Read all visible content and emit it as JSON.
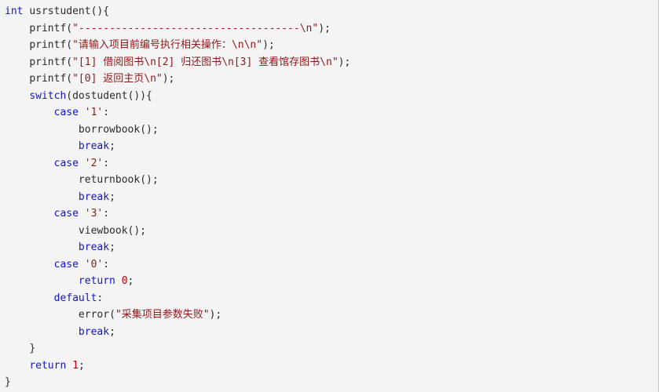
{
  "editor": {
    "language": "c",
    "background_color": "#f4f4f4",
    "colors": {
      "keyword": "#1515c4",
      "string": "#8b1a1a",
      "number": "#b8000c",
      "identifier": "#2b2b2b",
      "punctuation": "#2b2b2b"
    }
  },
  "code": {
    "lines": [
      {
        "indent": 0,
        "tokens": [
          {
            "kind": "kw",
            "text": "int"
          },
          {
            "kind": "plain",
            "text": " "
          },
          {
            "kind": "id",
            "text": "usrstudent"
          },
          {
            "kind": "punc",
            "text": "(){"
          }
        ]
      },
      {
        "indent": 1,
        "tokens": [
          {
            "kind": "id",
            "text": "printf"
          },
          {
            "kind": "punc",
            "text": "("
          },
          {
            "kind": "str",
            "text": "\"------------------------------------\\n\""
          },
          {
            "kind": "punc",
            "text": ");"
          }
        ]
      },
      {
        "indent": 1,
        "tokens": [
          {
            "kind": "id",
            "text": "printf"
          },
          {
            "kind": "punc",
            "text": "("
          },
          {
            "kind": "str",
            "text": "\"请输入项目前编号执行相关操作：\\n\\n\""
          },
          {
            "kind": "punc",
            "text": ");"
          }
        ]
      },
      {
        "indent": 1,
        "tokens": [
          {
            "kind": "id",
            "text": "printf"
          },
          {
            "kind": "punc",
            "text": "("
          },
          {
            "kind": "str",
            "text": "\"[1] 借阅图书\\n[2] 归还图书\\n[3] 查看馆存图书\\n\""
          },
          {
            "kind": "punc",
            "text": ");"
          }
        ]
      },
      {
        "indent": 1,
        "tokens": [
          {
            "kind": "id",
            "text": "printf"
          },
          {
            "kind": "punc",
            "text": "("
          },
          {
            "kind": "str",
            "text": "\"[0] 返回主页\\n\""
          },
          {
            "kind": "punc",
            "text": ");"
          }
        ]
      },
      {
        "indent": 1,
        "tokens": [
          {
            "kind": "kw",
            "text": "switch"
          },
          {
            "kind": "punc",
            "text": "("
          },
          {
            "kind": "id",
            "text": "dostudent"
          },
          {
            "kind": "punc",
            "text": "()){"
          }
        ]
      },
      {
        "indent": 2,
        "tokens": [
          {
            "kind": "kw",
            "text": "case"
          },
          {
            "kind": "plain",
            "text": " "
          },
          {
            "kind": "str",
            "text": "'1'"
          },
          {
            "kind": "punc",
            "text": ":"
          }
        ]
      },
      {
        "indent": 3,
        "tokens": [
          {
            "kind": "id",
            "text": "borrowbook"
          },
          {
            "kind": "punc",
            "text": "();"
          }
        ]
      },
      {
        "indent": 3,
        "tokens": [
          {
            "kind": "kw",
            "text": "break"
          },
          {
            "kind": "punc",
            "text": ";"
          }
        ]
      },
      {
        "indent": 2,
        "tokens": [
          {
            "kind": "kw",
            "text": "case"
          },
          {
            "kind": "plain",
            "text": " "
          },
          {
            "kind": "str",
            "text": "'2'"
          },
          {
            "kind": "punc",
            "text": ":"
          }
        ]
      },
      {
        "indent": 3,
        "tokens": [
          {
            "kind": "id",
            "text": "returnbook"
          },
          {
            "kind": "punc",
            "text": "();"
          }
        ]
      },
      {
        "indent": 3,
        "tokens": [
          {
            "kind": "kw",
            "text": "break"
          },
          {
            "kind": "punc",
            "text": ";"
          }
        ]
      },
      {
        "indent": 2,
        "tokens": [
          {
            "kind": "kw",
            "text": "case"
          },
          {
            "kind": "plain",
            "text": " "
          },
          {
            "kind": "str",
            "text": "'3'"
          },
          {
            "kind": "punc",
            "text": ":"
          }
        ]
      },
      {
        "indent": 3,
        "tokens": [
          {
            "kind": "id",
            "text": "viewbook"
          },
          {
            "kind": "punc",
            "text": "();"
          }
        ]
      },
      {
        "indent": 3,
        "tokens": [
          {
            "kind": "kw",
            "text": "break"
          },
          {
            "kind": "punc",
            "text": ";"
          }
        ]
      },
      {
        "indent": 2,
        "tokens": [
          {
            "kind": "kw",
            "text": "case"
          },
          {
            "kind": "plain",
            "text": " "
          },
          {
            "kind": "str",
            "text": "'0'"
          },
          {
            "kind": "punc",
            "text": ":"
          }
        ]
      },
      {
        "indent": 3,
        "tokens": [
          {
            "kind": "kw",
            "text": "return"
          },
          {
            "kind": "plain",
            "text": " "
          },
          {
            "kind": "num",
            "text": "0"
          },
          {
            "kind": "punc",
            "text": ";"
          }
        ]
      },
      {
        "indent": 2,
        "tokens": [
          {
            "kind": "kw",
            "text": "default"
          },
          {
            "kind": "punc",
            "text": ":"
          }
        ]
      },
      {
        "indent": 3,
        "tokens": [
          {
            "kind": "id",
            "text": "error"
          },
          {
            "kind": "punc",
            "text": "("
          },
          {
            "kind": "str",
            "text": "\"采集项目参数失败\""
          },
          {
            "kind": "punc",
            "text": ");"
          }
        ]
      },
      {
        "indent": 3,
        "tokens": [
          {
            "kind": "kw",
            "text": "break"
          },
          {
            "kind": "punc",
            "text": ";"
          }
        ]
      },
      {
        "indent": 1,
        "tokens": [
          {
            "kind": "punc",
            "text": "}"
          }
        ]
      },
      {
        "indent": 1,
        "tokens": [
          {
            "kind": "kw",
            "text": "return"
          },
          {
            "kind": "plain",
            "text": " "
          },
          {
            "kind": "num",
            "text": "1"
          },
          {
            "kind": "punc",
            "text": ";"
          }
        ]
      },
      {
        "indent": 0,
        "tokens": [
          {
            "kind": "punc",
            "text": "}"
          }
        ]
      }
    ]
  }
}
